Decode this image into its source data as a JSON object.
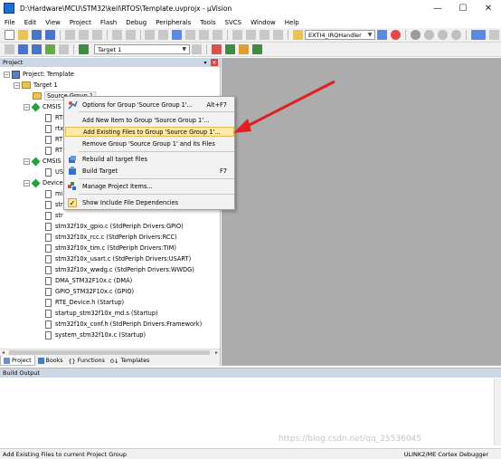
{
  "window": {
    "title": "D:\\Hardware\\MCU\\STM32\\keil\\RTOS\\Template.uvprojx - µVision",
    "controls": [
      "—",
      "☐",
      "✕"
    ]
  },
  "menubar": [
    "File",
    "Edit",
    "View",
    "Project",
    "Flash",
    "Debug",
    "Peripherals",
    "Tools",
    "SVCS",
    "Window",
    "Help"
  ],
  "toolbar": {
    "function_combo": "EXTI4_IRQHandler",
    "target_combo": "Target 1"
  },
  "project_panel": {
    "title": "Project",
    "tree": [
      {
        "label": "Project: Template",
        "level": 0
      },
      {
        "label": "Target 1",
        "level": 1
      },
      {
        "label": "Source Group 1",
        "level": 2
      },
      {
        "label": "CMSIS",
        "level": 2
      },
      {
        "label": "RTE",
        "level": 3
      },
      {
        "label": "rtx",
        "level": 3
      },
      {
        "label": "RT",
        "level": 3
      },
      {
        "label": "RT",
        "level": 3
      },
      {
        "label": "CMSIS",
        "level": 2
      },
      {
        "label": "US",
        "level": 3
      },
      {
        "label": "Device",
        "level": 2
      },
      {
        "label": "mi",
        "level": 3
      },
      {
        "label": "str",
        "level": 3
      },
      {
        "label": "str",
        "level": 3
      },
      {
        "label": "stm32f10x_gpio.c (StdPeriph Drivers:GPIO)",
        "level": 3
      },
      {
        "label": "stm32f10x_rcc.c (StdPeriph Drivers:RCC)",
        "level": 3
      },
      {
        "label": "stm32f10x_tim.c (StdPeriph Drivers:TIM)",
        "level": 3
      },
      {
        "label": "stm32f10x_usart.c (StdPeriph Drivers:USART)",
        "level": 3
      },
      {
        "label": "stm32f10x_wwdg.c (StdPeriph Drivers:WWDG)",
        "level": 3
      },
      {
        "label": "DMA_STM32F10x.c (DMA)",
        "level": 3
      },
      {
        "label": "GPIO_STM32F10x.c (GPIO)",
        "level": 3
      },
      {
        "label": "RTE_Device.h (Startup)",
        "level": 3
      },
      {
        "label": "startup_stm32f10x_md.s (Startup)",
        "level": 3
      },
      {
        "label": "stm32f10x_conf.h (StdPeriph Drivers:Framework)",
        "level": 3
      },
      {
        "label": "system_stm32f10x.c (Startup)",
        "level": 3
      }
    ],
    "tabs": [
      "Project",
      "Books",
      "Functions",
      "Templates"
    ]
  },
  "context_menu": {
    "items": [
      {
        "label": "Options for Group 'Source Group 1'...",
        "shortcut": "Alt+F7",
        "icon": "options-icon"
      },
      {
        "label": "Add New  Item to Group 'Source Group 1'...",
        "shortcut": "",
        "icon": ""
      },
      {
        "label": "Add Existing Files to Group 'Source Group 1'...",
        "shortcut": "",
        "icon": "",
        "highlighted": true
      },
      {
        "label": "Remove Group 'Source Group 1' and its Files",
        "shortcut": "",
        "icon": ""
      },
      {
        "label": "Rebuild all target files",
        "shortcut": "",
        "icon": "rebuild-icon"
      },
      {
        "label": "Build Target",
        "shortcut": "F7",
        "icon": "build-icon"
      },
      {
        "label": "Manage Project Items...",
        "shortcut": "",
        "icon": "manage-icon"
      },
      {
        "label": "Show Include File Dependencies",
        "shortcut": "",
        "icon": "check-icon",
        "checked": true
      }
    ]
  },
  "build_output": {
    "title": "Build Output"
  },
  "statusbar": {
    "message": "Add Existing Files to current Project Group",
    "debugger": "ULINK2/ME Cortex Debugger"
  },
  "watermark": "https://blog.csdn.net/qq_25536045",
  "colors": {
    "panel_header": "#ccd7e6",
    "editor_bg": "#acacac",
    "highlight": "#fde9a9",
    "arrow": "#e02020"
  }
}
